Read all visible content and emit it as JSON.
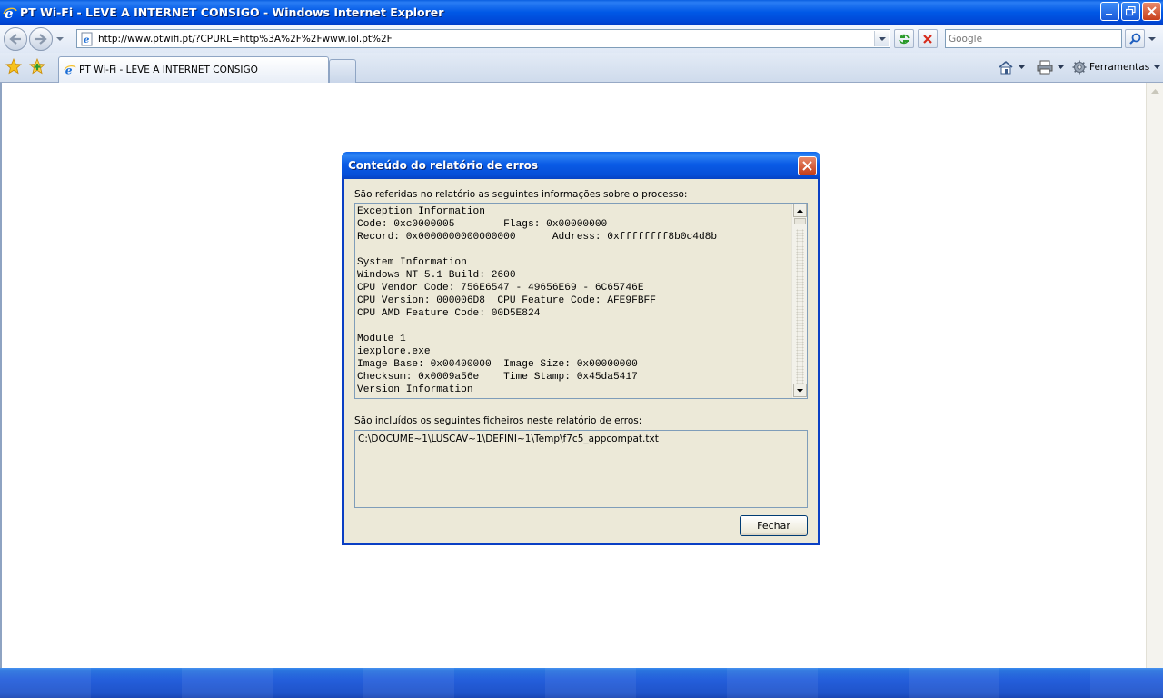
{
  "window": {
    "title": "PT Wi-Fi - LEVE A INTERNET CONSIGO - Windows Internet Explorer"
  },
  "address_bar": {
    "url": "http://www.ptwifi.pt/?CPURL=http%3A%2F%2Fwww.iol.pt%2F"
  },
  "search": {
    "placeholder": "Google"
  },
  "tabs": [
    {
      "label": "PT Wi-Fi - LEVE A INTERNET CONSIGO"
    }
  ],
  "command_bar": {
    "tools_label": "Ferramentas"
  },
  "dialog": {
    "title": "Conteúdo do relatório de erros",
    "info_label": "São referidas no relatório as seguintes informações sobre o processo:",
    "report_lines": "Exception Information\nCode: 0xc0000005        Flags: 0x00000000\nRecord: 0x0000000000000000      Address: 0xffffffff8b0c4d8b\n\nSystem Information\nWindows NT 5.1 Build: 2600\nCPU Vendor Code: 756E6547 - 49656E69 - 6C65746E\nCPU Version: 000006D8  CPU Feature Code: AFE9FBFF\nCPU AMD Feature Code: 00D5E824\n\nModule 1\niexplore.exe\nImage Base: 0x00400000  Image Size: 0x00000000\nChecksum: 0x0009a56e    Time Stamp: 0x45da5417\nVersion Information",
    "files_label": "São incluídos os seguintes ficheiros neste relatório de erros:",
    "files_value": "C:\\DOCUME~1\\LUSCAV~1\\DEFINI~1\\Temp\\f7c5_appcompat.txt",
    "close_button": "Fechar"
  },
  "icons": {
    "ie_logo": "ie-logo-icon",
    "back": "back-arrow-icon",
    "forward": "forward-arrow-icon",
    "refresh": "refresh-icon",
    "stop": "stop-icon",
    "search_go": "search-icon",
    "favorites": "favorites-star-icon",
    "add_favorite": "add-favorite-icon",
    "home": "home-icon",
    "print": "printer-icon",
    "tools": "gear-icon"
  },
  "colors": {
    "xp_blue": "#0a5be6",
    "dialog_face": "#ece9d8",
    "close_red": "#c63f1a"
  }
}
